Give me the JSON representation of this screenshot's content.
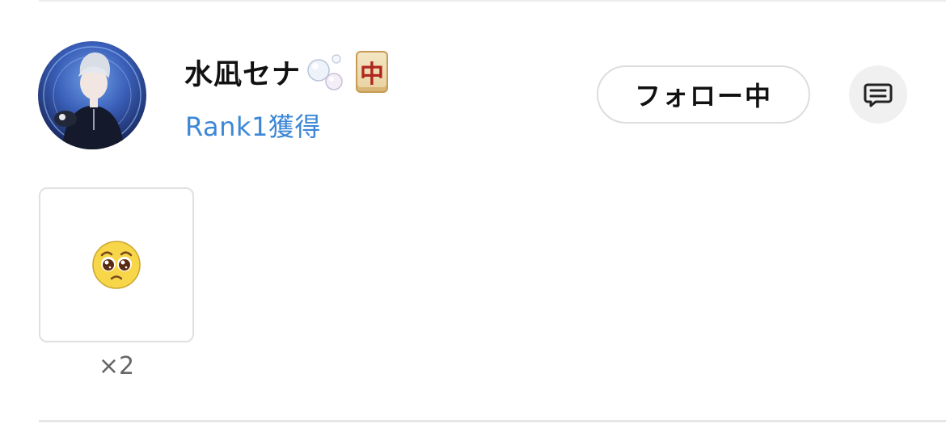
{
  "user": {
    "name": "水凪セナ",
    "name_emojis": [
      "bubbles-icon",
      "mahjong-red-dragon-icon"
    ],
    "mahjong_glyph": "中",
    "rank_label": "Rank1獲得"
  },
  "actions": {
    "follow_label": "フォロー中",
    "message_icon": "message-icon"
  },
  "reactions": [
    {
      "emoji": "pleading-face-icon",
      "count_label": "×2"
    }
  ],
  "colors": {
    "rank_text": "#3c87d6",
    "follow_border": "#dddddd",
    "message_bg": "#f0f0f0"
  }
}
